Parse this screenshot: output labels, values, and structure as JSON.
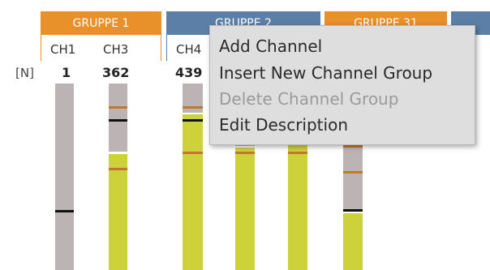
{
  "unit_label": "[N]",
  "groups": [
    {
      "title": "GRUPPE 1",
      "color": "#e8902a"
    },
    {
      "title": "GRUPPE 2",
      "color": "#5b7fa6"
    },
    {
      "title": "GRUPPE 31",
      "color": "#e8902a"
    }
  ],
  "channels": [
    {
      "name": "CH1",
      "count": "1"
    },
    {
      "name": "CH3",
      "count": "362"
    },
    {
      "name": "CH4",
      "count": "439"
    }
  ],
  "context_menu": {
    "items": [
      {
        "label": "Add Channel",
        "enabled": true
      },
      {
        "label": "Insert New Channel Group",
        "enabled": true
      },
      {
        "label": "Delete Channel Group",
        "enabled": false
      },
      {
        "label": "Edit Description",
        "enabled": true
      }
    ]
  },
  "colors": {
    "bar_gray": "#bbb3b4",
    "bar_yellow": "#cdd13a",
    "marker_orange": "#c07830",
    "marker_black": "#111111"
  }
}
